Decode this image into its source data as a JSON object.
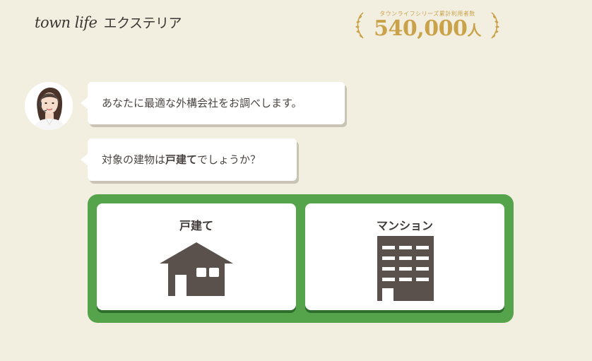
{
  "header": {
    "brand": "town life",
    "brand_sub": "エクステリア",
    "badge_caption": "タウンライフシリーズ累計利用者数",
    "badge_count": "540,000",
    "badge_unit": "人"
  },
  "chat": {
    "message1": "あなたに最適な外構会社をお調べします。",
    "message2_before": "対象の建物は",
    "message2_bold": "戸建て",
    "message2_after": "でしょうか？"
  },
  "options": [
    {
      "label": "戸建て",
      "icon": "house-icon"
    },
    {
      "label": "マンション",
      "icon": "building-icon"
    }
  ],
  "colors": {
    "background": "#f3efe0",
    "accent_green": "#55a44c",
    "gold": "#c9a24a",
    "icon_dark": "#5a514d"
  }
}
